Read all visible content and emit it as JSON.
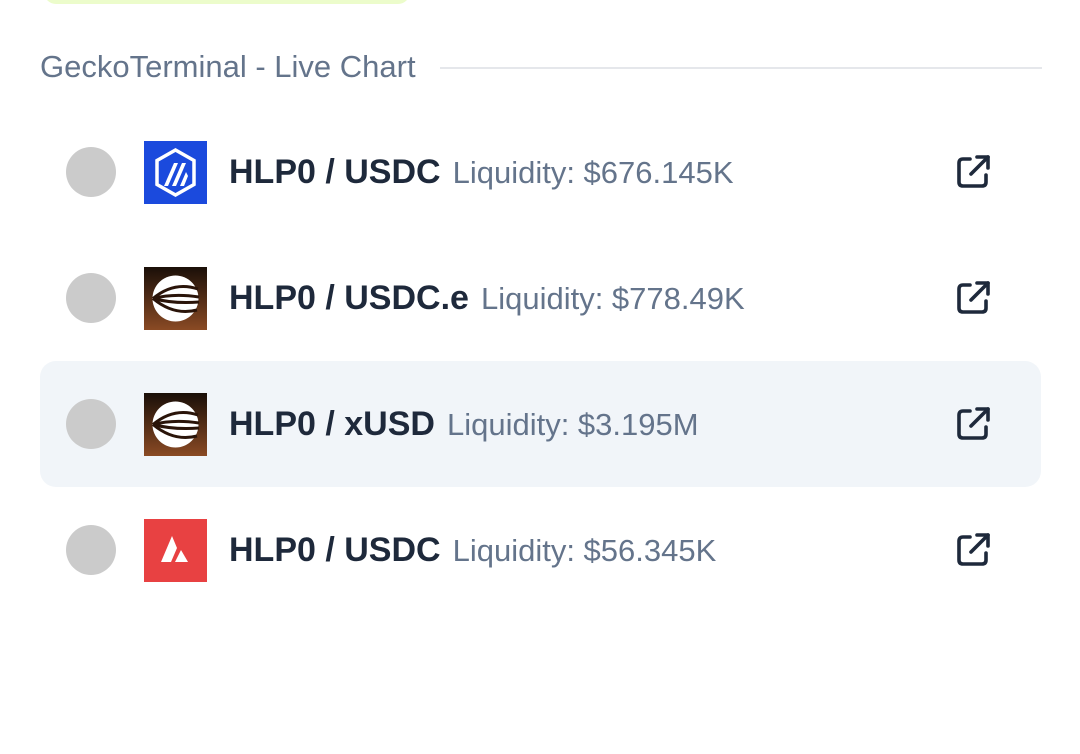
{
  "section": {
    "title": "GeckoTerminal - Live Chart"
  },
  "pools": [
    {
      "pair": "HLP0 / USDC",
      "liquidity": "Liquidity: $676.145K",
      "chain_icon": "arbitrum-icon",
      "chain_color": "#1b4add",
      "selected": false
    },
    {
      "pair": "HLP0 / USDC.e",
      "liquidity": "Liquidity: $778.49K",
      "chain_icon": "chain-logo-icon",
      "chain_color": "#6b3a1f",
      "selected": false
    },
    {
      "pair": "HLP0 / xUSD",
      "liquidity": "Liquidity: $3.195M",
      "chain_icon": "chain-logo-icon",
      "chain_color": "#6b3a1f",
      "selected": true
    },
    {
      "pair": "HLP0 / USDC",
      "liquidity": "Liquidity: $56.345K",
      "chain_icon": "avalanche-icon",
      "chain_color": "#e84142",
      "selected": false
    }
  ],
  "colors": {
    "text_primary": "#1e293b",
    "text_muted": "#64748b",
    "selected_row_bg": "#f1f5f9",
    "radio": "#cbcbcb"
  }
}
